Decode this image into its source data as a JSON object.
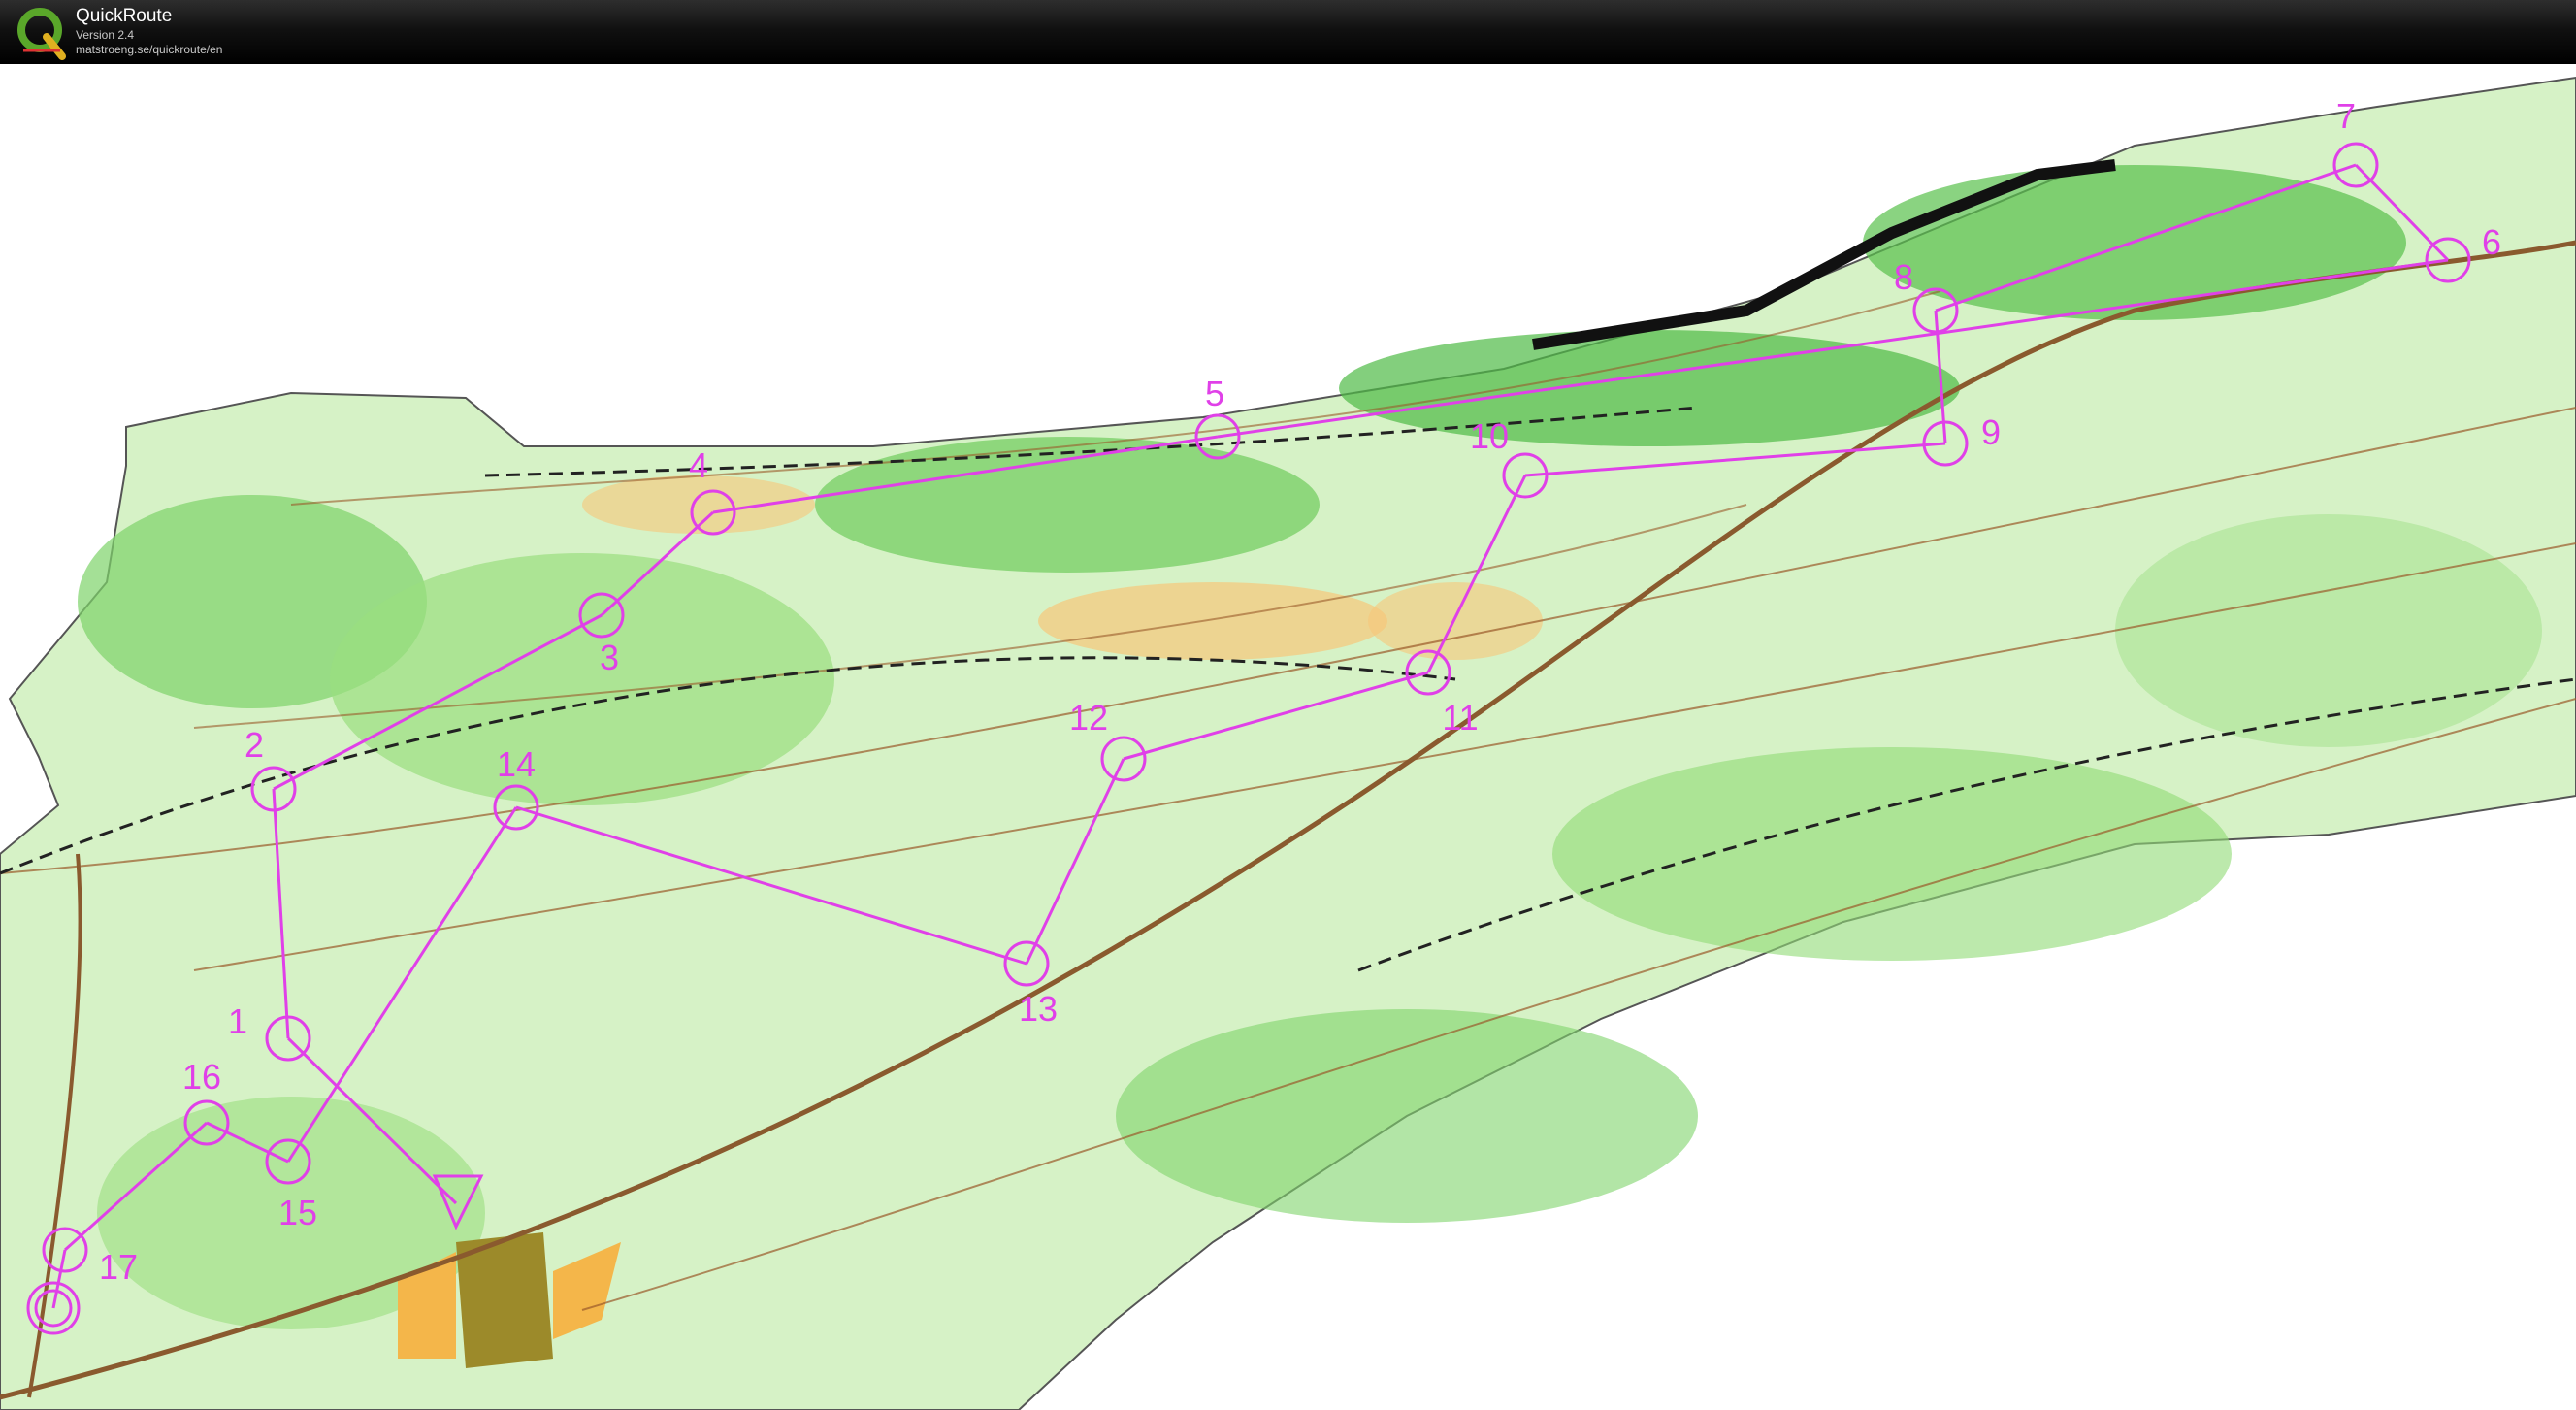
{
  "app": {
    "title": "QuickRoute",
    "version": "Version 2.4",
    "url": "matstroeng.se/quickroute/en",
    "logo_letter": "Q"
  },
  "colors": {
    "course": "#e040e8",
    "forest_light": "#c8f0b0",
    "forest_mid": "#7ed36a",
    "forest_dark": "#2fa83a",
    "open_land": "#f6c77a",
    "contour": "#9a5a2a",
    "road": "#8a5a2e"
  },
  "course": {
    "start_label": "start-triangle",
    "controls": [
      {
        "num": "1"
      },
      {
        "num": "2"
      },
      {
        "num": "3"
      },
      {
        "num": "4"
      },
      {
        "num": "5"
      },
      {
        "num": "6"
      },
      {
        "num": "7"
      },
      {
        "num": "8"
      },
      {
        "num": "9"
      },
      {
        "num": "10"
      },
      {
        "num": "11"
      },
      {
        "num": "12"
      },
      {
        "num": "13"
      },
      {
        "num": "14"
      },
      {
        "num": "15"
      },
      {
        "num": "16"
      },
      {
        "num": "17"
      }
    ],
    "finish_label": "finish-circle"
  }
}
